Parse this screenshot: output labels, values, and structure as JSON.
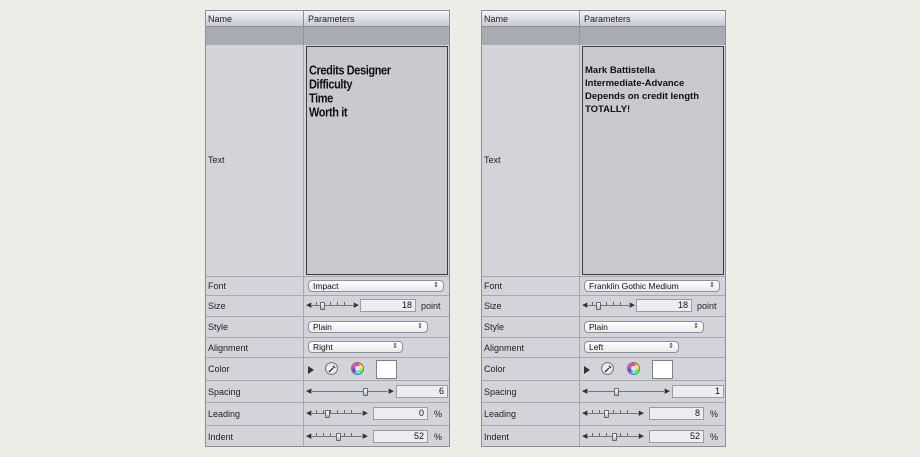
{
  "header": {
    "col_name": "Name",
    "col_params": "Parameters"
  },
  "labels": {
    "text": "Text",
    "font": "Font",
    "size": "Size",
    "style": "Style",
    "alignment": "Alignment",
    "color": "Color",
    "spacing": "Spacing",
    "leading": "Leading",
    "indent": "Indent"
  },
  "units": {
    "point": "point",
    "percent": "%"
  },
  "icons": {
    "popup_arrow": "up-down-arrows-icon",
    "disclosure": "triangle-right-icon",
    "eyedropper": "eyedropper-icon",
    "color_wheel": "color-wheel-icon"
  },
  "left": {
    "text_lines": [
      "Credits Designer",
      "Difficulty",
      "Time",
      "Worth it"
    ],
    "font": "Impact",
    "size": "18",
    "style": "Plain",
    "alignment": "Right",
    "color": "#ffffff",
    "spacing": "6",
    "leading": "0",
    "indent": "52"
  },
  "right": {
    "text_lines": [
      "Mark Battistella",
      "Intermediate-Advance",
      "Depends on credit length",
      "TOTALLY!"
    ],
    "font": "Franklin Gothic Medium",
    "size": "18",
    "style": "Plain",
    "alignment": "Left",
    "color": "#ffffff",
    "spacing": "1",
    "leading": "8",
    "indent": "52"
  }
}
